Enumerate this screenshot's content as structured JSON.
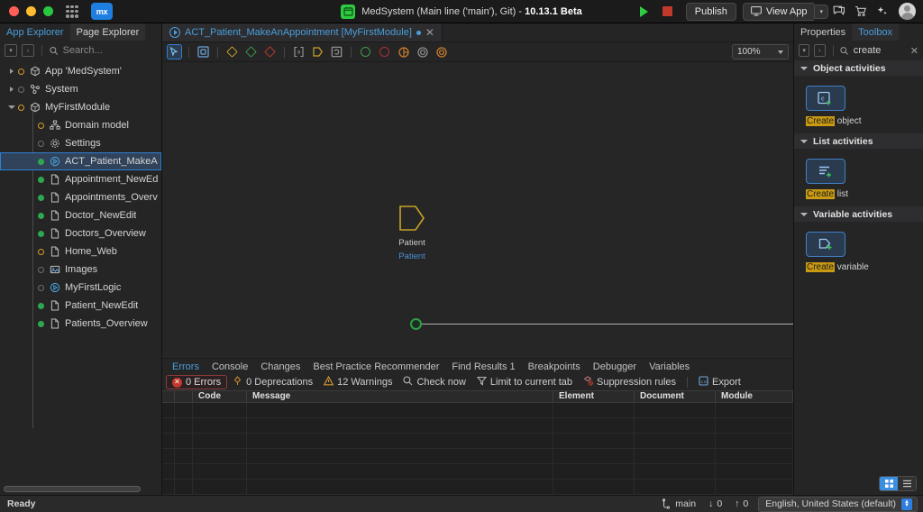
{
  "titlebar": {
    "app_title_normal": "MedSystem (Main line ('main'), Git)  -  ",
    "app_title_version": "10.13.1 Beta",
    "publish_label": "Publish",
    "view_app_label": "View App",
    "logo_text": "mx"
  },
  "left_panel": {
    "tabs": [
      {
        "label": "App Explorer",
        "active": true
      },
      {
        "label": "Page Explorer",
        "active": false
      }
    ],
    "search_placeholder": "Search...",
    "tree": [
      {
        "label": "App 'MedSystem'",
        "indent": 0,
        "twisty": "closed",
        "dot": "orange",
        "icon": "app-icon"
      },
      {
        "label": "System",
        "indent": 0,
        "twisty": "closed",
        "dot": "empty",
        "icon": "system-icon"
      },
      {
        "label": "MyFirstModule",
        "indent": 0,
        "twisty": "open",
        "dot": "orange",
        "icon": "module-icon"
      },
      {
        "label": "Domain model",
        "indent": 1,
        "twisty": "none",
        "dot": "orange",
        "icon": "domain-model-icon"
      },
      {
        "label": "Settings",
        "indent": 1,
        "twisty": "none",
        "dot": "empty",
        "icon": "gear-icon"
      },
      {
        "label": "ACT_Patient_MakeAnAppointment",
        "indent": 1,
        "twisty": "none",
        "dot": "green-filled",
        "icon": "microflow-icon",
        "selected": true
      },
      {
        "label": "Appointment_NewEdit",
        "indent": 1,
        "twisty": "none",
        "dot": "green-filled",
        "icon": "page-icon"
      },
      {
        "label": "Appointments_Overview",
        "indent": 1,
        "twisty": "none",
        "dot": "green-filled",
        "icon": "page-icon"
      },
      {
        "label": "Doctor_NewEdit",
        "indent": 1,
        "twisty": "none",
        "dot": "green-filled",
        "icon": "page-icon"
      },
      {
        "label": "Doctors_Overview",
        "indent": 1,
        "twisty": "none",
        "dot": "green-filled",
        "icon": "page-icon"
      },
      {
        "label": "Home_Web",
        "indent": 1,
        "twisty": "none",
        "dot": "orange",
        "icon": "page-icon"
      },
      {
        "label": "Images",
        "indent": 1,
        "twisty": "none",
        "dot": "empty",
        "icon": "images-icon"
      },
      {
        "label": "MyFirstLogic",
        "indent": 1,
        "twisty": "none",
        "dot": "empty",
        "icon": "microflow-icon"
      },
      {
        "label": "Patient_NewEdit",
        "indent": 1,
        "twisty": "none",
        "dot": "green-filled",
        "icon": "page-icon"
      },
      {
        "label": "Patients_Overview",
        "indent": 1,
        "twisty": "none",
        "dot": "green-filled",
        "icon": "page-icon"
      }
    ]
  },
  "editor": {
    "tab_title": "ACT_Patient_MakeAnAppointment [MyFirstModule]",
    "zoom_level": "100%",
    "canvas": {
      "parameter_name": "Patient",
      "parameter_type": "Patient"
    }
  },
  "dock": {
    "tabs": [
      {
        "label": "Errors",
        "active": true
      },
      {
        "label": "Console",
        "active": false
      },
      {
        "label": "Changes",
        "active": false
      },
      {
        "label": "Best Practice Recommender",
        "active": false
      },
      {
        "label": "Find Results 1",
        "active": false
      },
      {
        "label": "Breakpoints",
        "active": false
      },
      {
        "label": "Debugger",
        "active": false
      },
      {
        "label": "Variables",
        "active": false
      }
    ],
    "toolbar": {
      "errors": "0 Errors",
      "deprecations": "0 Deprecations",
      "warnings": "12 Warnings",
      "check_now": "Check now",
      "limit_to_tab": "Limit to current tab",
      "suppression_rules": "Suppression rules",
      "export": "Export"
    },
    "columns": [
      "",
      "",
      "Code",
      "Message",
      "Element",
      "Document",
      "Module"
    ],
    "rows": []
  },
  "right_panel": {
    "tabs": [
      {
        "label": "Properties",
        "active": false
      },
      {
        "label": "Toolbox",
        "active": true
      }
    ],
    "search_value": "create",
    "sections": [
      {
        "title": "Object activities",
        "items": [
          {
            "label_highlight": "Create",
            "label_rest": " object",
            "icon": "create-object-icon"
          }
        ]
      },
      {
        "title": "List activities",
        "items": [
          {
            "label_highlight": "Create",
            "label_rest": " list",
            "icon": "create-list-icon"
          }
        ]
      },
      {
        "title": "Variable activities",
        "items": [
          {
            "label_highlight": "Create",
            "label_rest": " variable",
            "icon": "create-variable-icon"
          }
        ]
      }
    ]
  },
  "statusbar": {
    "status": "Ready",
    "branch": "main",
    "incoming": "0",
    "outgoing": "0",
    "language": "English, United States (default)"
  }
}
